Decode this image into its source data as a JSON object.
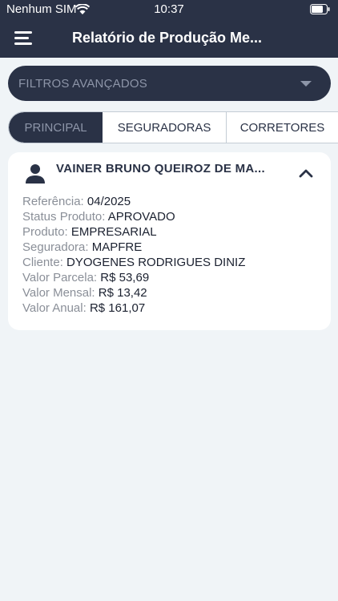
{
  "status_bar": {
    "carrier": "Nenhum SIM",
    "time": "10:37"
  },
  "header": {
    "title": "Relatório de Produção Me..."
  },
  "filters": {
    "label": "FILTROS AVANÇADOS"
  },
  "tabs": [
    {
      "label": "PRINCIPAL",
      "active": true
    },
    {
      "label": "SEGURADORAS",
      "active": false
    },
    {
      "label": "CORRETORES",
      "active": false
    }
  ],
  "card": {
    "title": "VAINER BRUNO QUEIROZ DE MA...",
    "fields": [
      {
        "label": "Referência:",
        "value": "04/2025"
      },
      {
        "label": "Status Produto:",
        "value": "APROVADO"
      },
      {
        "label": "Produto:",
        "value": "EMPRESARIAL"
      },
      {
        "label": "Seguradora:",
        "value": "MAPFRE"
      },
      {
        "label": "Cliente:",
        "value": "DYOGENES RODRIGUES DINIZ"
      },
      {
        "label": "Valor Parcela:",
        "value": "R$ 53,69"
      },
      {
        "label": "Valor Mensal:",
        "value": "R$ 13,42"
      },
      {
        "label": "Valor Anual:",
        "value": "R$ 161,07"
      }
    ]
  },
  "colors": {
    "primary": "#2a3246",
    "background": "#f0f4f7",
    "muted": "#8d95a8"
  }
}
